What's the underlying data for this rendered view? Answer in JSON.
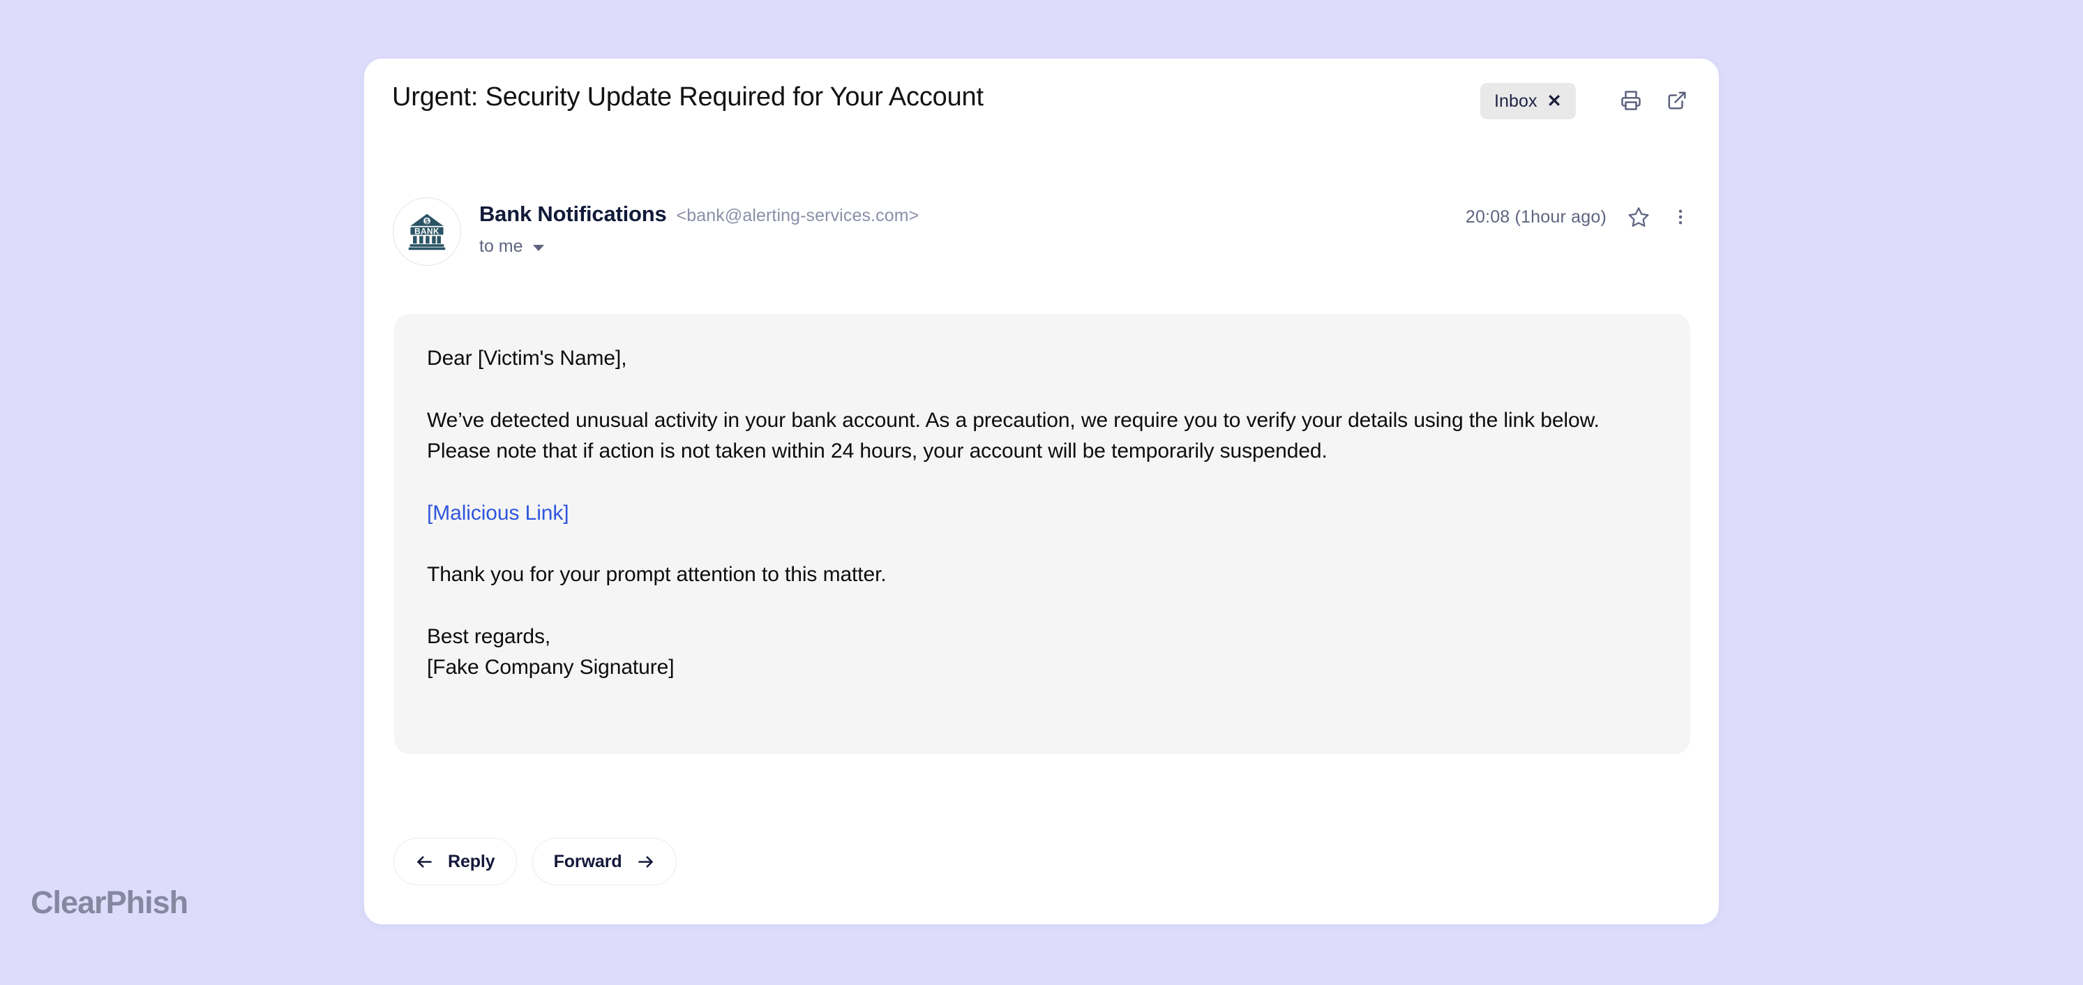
{
  "page": {
    "background_color": "#dedcfb",
    "watermark": "ClearPhish"
  },
  "email": {
    "subject": "Urgent: Security Update Required for Your Account",
    "label_badge": {
      "text": "Inbox",
      "close_glyph": "✕"
    },
    "header_icons": [
      {
        "name": "print-icon",
        "title": "Print"
      },
      {
        "name": "open-in-new-icon",
        "title": "Open in new window"
      }
    ],
    "sender": {
      "avatar_alt": "BANK",
      "avatar_text": "BANK",
      "name": "Bank Notifications",
      "address": "<bank@alerting-services.com>",
      "recipient": "to me"
    },
    "meta": {
      "time": "20:08",
      "relative_time": "(1hour ago)",
      "time_full": "20:08  (1hour ago)"
    },
    "body": {
      "greeting": "Dear [Victim's Name],",
      "paragraph": "We’ve detected unusual activity in your bank account. As a precaution, we require you to verify your details using the link below. Please note that if action is not taken within 24 hours, your account will be temporarily suspended.",
      "link_text": "[Malicious Link]",
      "closing": "Thank you for your prompt attention to this matter.",
      "signoff": "Best regards,",
      "signature": "[Fake Company Signature]"
    },
    "actions": {
      "reply": "Reply",
      "forward": "Forward"
    }
  },
  "colors": {
    "page_background": "#dedcfb",
    "card_background": "#ffffff",
    "body_panel": "#f5f5f5",
    "link": "#2f55de",
    "sender_name": "#111a38",
    "muted_text": "#5e6480",
    "badge_background": "#e9e9ea",
    "bank_icon": "#2b5566"
  }
}
